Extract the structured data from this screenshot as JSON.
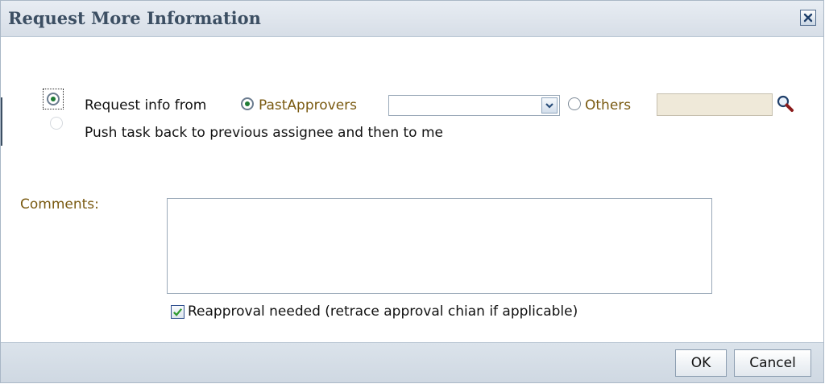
{
  "dialog": {
    "title": "Request More Information",
    "close_icon": "close-icon"
  },
  "options": {
    "request_info_label": "Request info from",
    "past_approvers_label": "PastApprovers",
    "past_approvers_selected": "",
    "others_label": "Others",
    "others_value": "",
    "push_back_label": "Push task back to previous assignee and then to me"
  },
  "comments": {
    "label": "Comments:",
    "value": ""
  },
  "reapproval": {
    "label": "Reapproval needed (retrace approval chian if applicable)",
    "checked": true
  },
  "footer": {
    "ok_label": "OK",
    "cancel_label": "Cancel"
  },
  "colors": {
    "title_text": "#3c4f63",
    "label_accent": "#7a5a11",
    "radio_selected": "#1f7c35",
    "others_field_bg": "#efe9d9"
  }
}
